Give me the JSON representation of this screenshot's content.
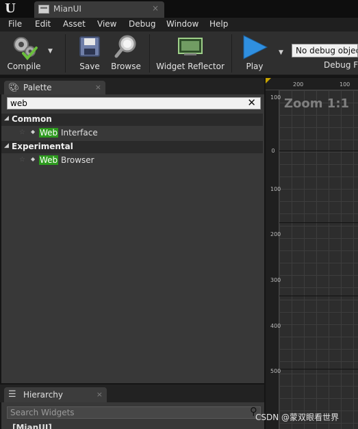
{
  "window": {
    "document_tab": "MianUI",
    "close_glyph": "×"
  },
  "menu": [
    "File",
    "Edit",
    "Asset",
    "View",
    "Debug",
    "Window",
    "Help"
  ],
  "toolbar": {
    "compile": "Compile",
    "save": "Save",
    "browse": "Browse",
    "widget_reflector": "Widget Reflector",
    "play": "Play",
    "debug_object": "No debug object selected",
    "debug_filter": "Debug Filter"
  },
  "palette": {
    "tab_label": "Palette",
    "search_value": "web",
    "categories": [
      {
        "label": "Common",
        "items": [
          {
            "match": "Web",
            "rest": " Interface"
          }
        ]
      },
      {
        "label": "Experimental",
        "items": [
          {
            "match": "Web",
            "rest": " Browser"
          }
        ]
      }
    ]
  },
  "hierarchy": {
    "tab_label": "Hierarchy",
    "search_placeholder": "Search Widgets",
    "root": "[MianUI]"
  },
  "designer": {
    "zoom": "Zoom 1:1",
    "h_ticks": [
      "200",
      "100"
    ],
    "v_ticks": [
      "100",
      "0",
      "100",
      "200",
      "300",
      "400",
      "500"
    ]
  },
  "watermark": "CSDN @蒙双眼看世界",
  "colors": {
    "search_highlight": "#2d9a1e",
    "compile_check": "#6abf3c",
    "play_arrow": "#2f8fe0"
  }
}
